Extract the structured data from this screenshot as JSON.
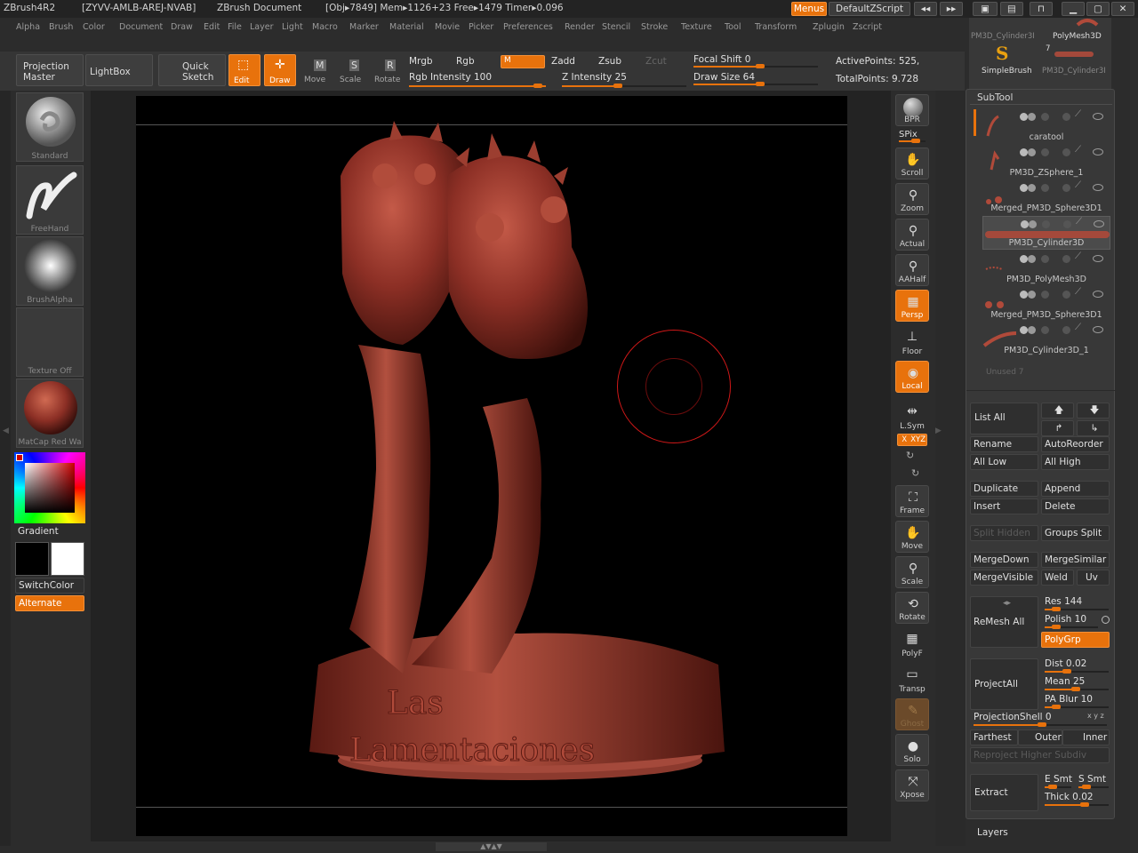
{
  "title_bar": {
    "app": "ZBrush4R2",
    "key": "[ZYVV-AMLB-AREJ-NVAB]",
    "doc": "ZBrush Document",
    "stats": "[Obj▸7849] Mem▸1126+23  Free▸1479  Timer▸0.096",
    "menus_btn": "Menus",
    "script_btn": "DefaultZScript"
  },
  "menu_bar": [
    "Alpha",
    "Brush",
    "Color",
    "Document",
    "Draw",
    "Edit",
    "File",
    "Layer",
    "Light",
    "Macro",
    "Marker",
    "Material",
    "Movie",
    "Picker",
    "Preferences",
    "Render",
    "Stencil",
    "Stroke",
    "Texture",
    "Tool",
    "Transform",
    "Zplugin",
    "Zscript"
  ],
  "toolbar": {
    "projection_master": "Projection Master",
    "lightbox": "LightBox",
    "quick_sketch": "Quick Sketch",
    "edit": "Edit",
    "draw": "Draw",
    "move": "Move",
    "scale": "Scale",
    "rotate": "Rotate",
    "mrgb": "Mrgb",
    "rgb": "Rgb",
    "m": "M",
    "zadd": "Zadd",
    "zsub": "Zsub",
    "zcut": "Zcut",
    "rgb_intensity": "Rgb Intensity 100",
    "z_intensity": "Z Intensity 25",
    "focal_shift": "Focal Shift 0",
    "draw_size": "Draw Size 64",
    "active_points": "ActivePoints: 525,",
    "total_points": "TotalPoints: 9.728",
    "rgb_intensity_value": 100,
    "z_intensity_value": 25,
    "draw_size_value": 64
  },
  "left_tray": {
    "standard": "Standard",
    "freehand": "FreeHand",
    "brushalpha": "BrushAlpha",
    "texture": "Texture  Off",
    "matcap": "MatCap  Red  Wa",
    "gradient": "Gradient",
    "switchcolor": "SwitchColor",
    "alternate": "Alternate"
  },
  "viewport": {
    "sculpt_text_line1": "Las",
    "sculpt_text_line2": "Lamentaciones"
  },
  "right_shelf": {
    "bpr": "BPR",
    "spix": "SPix",
    "scroll": "Scroll",
    "zoom": "Zoom",
    "actual": "Actual",
    "aahalf": "AAHalf",
    "persp": "Persp",
    "floor": "Floor",
    "local": "Local",
    "lsym": "L.Sym",
    "xyz": "Ｘ XYZ",
    "frame": "Frame",
    "move": "Move",
    "scale": "Scale",
    "rotate": "Rotate",
    "polyf": "PolyF",
    "transp": "Transp",
    "ghost": "Ghost",
    "solo": "Solo",
    "xpose": "Xpose"
  },
  "tool_thumbs": {
    "pm3d_cyl": "PM3D_Cylinder3I",
    "polymesh": "PolyMesh3D",
    "simplebrush": "SimpleBrush",
    "pm3d_cyl2": "PM3D_Cylinder3I",
    "count": "7"
  },
  "subtool": {
    "title": "SubTool",
    "items": [
      {
        "name": "caratool"
      },
      {
        "name": "PM3D_ZSphere_1"
      },
      {
        "name": "Merged_PM3D_Sphere3D1"
      },
      {
        "name": "PM3D_Cylinder3D"
      },
      {
        "name": "PM3D_PolyMesh3D"
      },
      {
        "name": "Merged_PM3D_Sphere3D1"
      },
      {
        "name": "PM3D_Cylinder3D_1"
      }
    ],
    "unused": "Unused  7",
    "list_all": "List  All",
    "rename": "Rename",
    "autoreorder": "AutoReorder",
    "all_low": "All  Low",
    "all_high": "All  High",
    "duplicate": "Duplicate",
    "append": "Append",
    "insert": "Insert",
    "delete": "Delete",
    "split_hidden": "Split  Hidden",
    "groups_split": "Groups  Split",
    "mergedown": "MergeDown",
    "mergesimilar": "MergeSimilar",
    "mergevisible": "MergeVisible",
    "weld": "Weld",
    "uv": "Uv",
    "remesh_all": "ReMesh  All",
    "res": "Res 144",
    "polish": "Polish 10",
    "polygrp": "PolyGrp",
    "projectall": "ProjectAll",
    "dist": "Dist 0.02",
    "mean": "Mean 25",
    "pa_blur": "PA  Blur 10",
    "projectionshell": "ProjectionShell 0",
    "xyz_small": "x y z",
    "farthest": "Farthest",
    "outer": "Outer",
    "inner": "Inner",
    "reproject": "Reproject  Higher  Subdiv",
    "extract": "Extract",
    "e_smt": "E  Smt",
    "s_smt": "S  Smt",
    "thick": "Thick 0.02",
    "layers": "Layers"
  },
  "colors": {
    "accent": "#e8720c",
    "clay": "#8c2f25"
  }
}
